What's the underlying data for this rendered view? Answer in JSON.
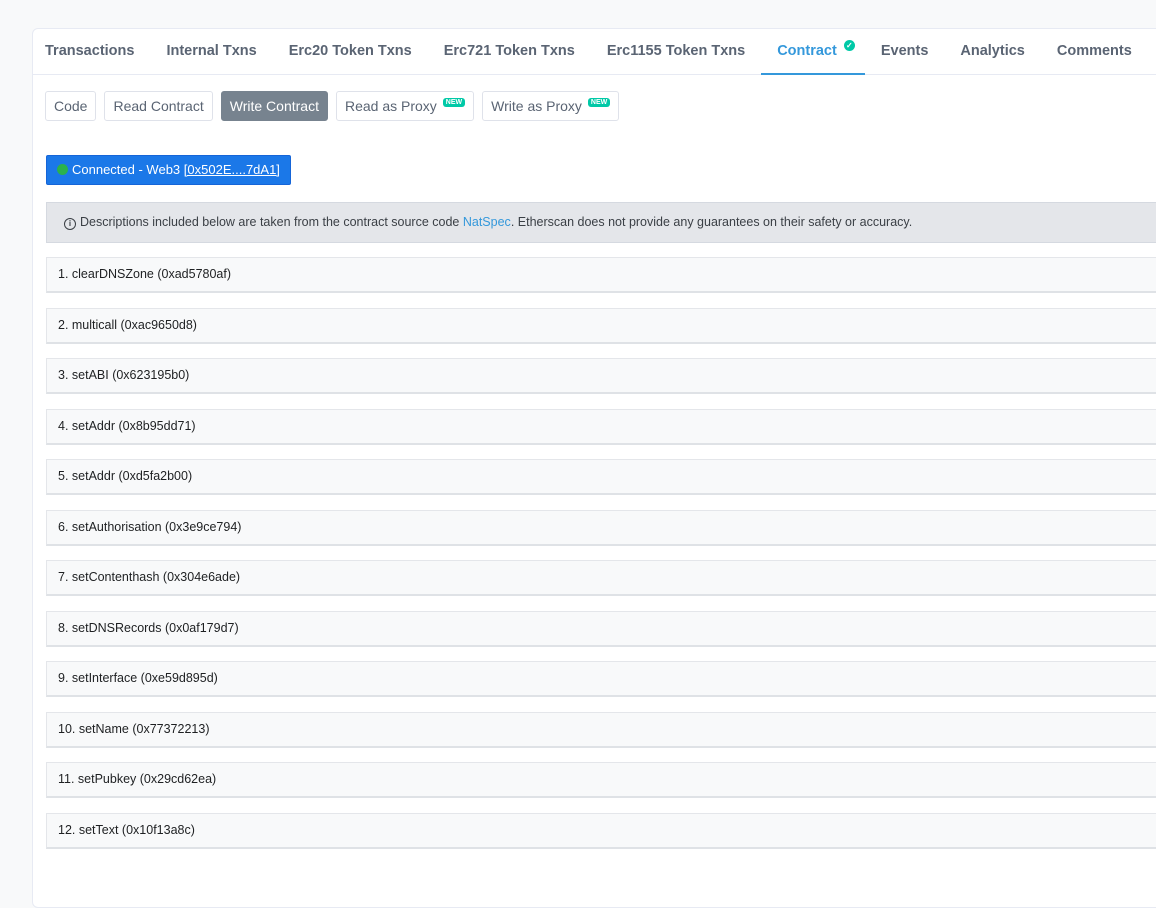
{
  "tabs": [
    {
      "label": "Transactions"
    },
    {
      "label": "Internal Txns"
    },
    {
      "label": "Erc20 Token Txns"
    },
    {
      "label": "Erc721 Token Txns"
    },
    {
      "label": "Erc1155 Token Txns"
    },
    {
      "label": "Contract",
      "active": true,
      "verified": true
    },
    {
      "label": "Events"
    },
    {
      "label": "Analytics"
    },
    {
      "label": "Comments"
    }
  ],
  "subtabs": [
    {
      "label": "Code"
    },
    {
      "label": "Read Contract"
    },
    {
      "label": "Write Contract",
      "active": true
    },
    {
      "label": "Read as Proxy",
      "badge": "NEW"
    },
    {
      "label": "Write as Proxy",
      "badge": "NEW"
    }
  ],
  "connection": {
    "text": "Connected - Web3",
    "address": "[0x502E....7dA1]"
  },
  "notice": {
    "text_before": "Descriptions included below are taken from the contract source code",
    "link": "NatSpec",
    "text_after": ". Etherscan does not provide any guarantees on their safety or accuracy."
  },
  "functions": [
    "1. clearDNSZone (0xad5780af)",
    "2. multicall (0xac9650d8)",
    "3. setABI (0x623195b0)",
    "4. setAddr (0x8b95dd71)",
    "5. setAddr (0xd5fa2b00)",
    "6. setAuthorisation (0x3e9ce794)",
    "7. setContenthash (0x304e6ade)",
    "8. setDNSRecords (0x0af179d7)",
    "9. setInterface (0xe59d895d)",
    "10. setName (0x77372213)",
    "11. setPubkey (0x29cd62ea)",
    "12. setText (0x10f13a8c)"
  ],
  "colors": {
    "accent": "#3498db",
    "connected_bg": "#1b78e8",
    "status_green": "#2bb24c",
    "badge_teal": "#00c9a7",
    "active_subtab": "#77838f"
  }
}
